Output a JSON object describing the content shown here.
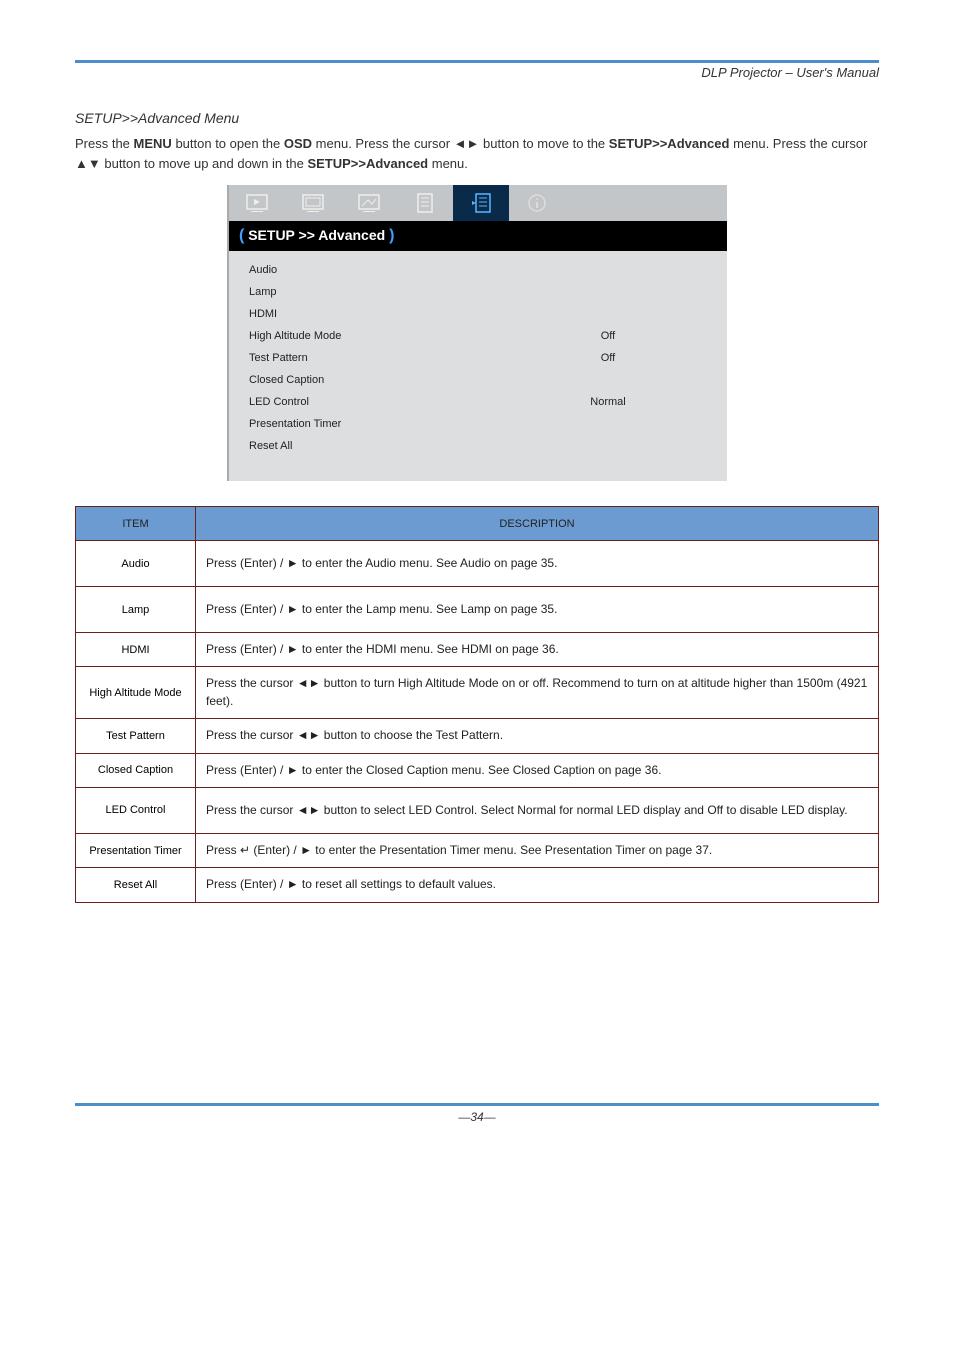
{
  "header": "DLP Projector – User's Manual",
  "section_title": "SETUP>>Advanced Menu",
  "instructions_prefix": "Press the ",
  "instructions_1": " button to open the ",
  "instructions_osd": "OSD",
  "instructions_2": " menu. Press the cursor ",
  "instructions_3": " button to move to the ",
  "instructions_menu_bold": "SETUP>>Advanced",
  "instructions_4": " menu. Press the cursor ",
  "instructions_5": " button to move up and down in the ",
  "instructions_6": " menu.",
  "menu_btn": "MENU",
  "osd": {
    "breadcrumb": "SETUP >> Advanced",
    "items": [
      {
        "label": "Audio",
        "value": ""
      },
      {
        "label": "Lamp",
        "value": ""
      },
      {
        "label": "HDMI",
        "value": ""
      },
      {
        "label": "High Altitude Mode",
        "value": "Off"
      },
      {
        "label": "Test Pattern",
        "value": "Off"
      },
      {
        "label": "Closed Caption",
        "value": ""
      },
      {
        "label": "LED Control",
        "value": "Normal"
      },
      {
        "label": "Presentation Timer",
        "value": ""
      },
      {
        "label": "Reset All",
        "value": ""
      }
    ]
  },
  "table": {
    "headers": [
      "ITEM",
      "DESCRIPTION"
    ],
    "rows": [
      {
        "item": "Audio",
        "desc_pre": "Press ",
        "desc_post": " (Enter) / ► to enter the Audio menu. See Audio on page 35.",
        "h": "md"
      },
      {
        "item": "Lamp",
        "desc_pre": "Press ",
        "desc_post": " (Enter) / ► to enter the Lamp menu. See Lamp on page 35.",
        "h": "md"
      },
      {
        "item": "HDMI",
        "desc_pre": "Press ",
        "desc_post": " (Enter) / ► to enter the HDMI menu. See HDMI on page 36.",
        "h": "sm"
      },
      {
        "item": "High Altitude Mode",
        "desc_pre": "Press the cursor ",
        "desc_post": " button to turn High Altitude Mode on or off. Recommend to turn on at altitude higher than 1500m (4921 feet).",
        "mode": "lr",
        "h": "md"
      },
      {
        "item": "Test Pattern",
        "desc_pre": "Press the cursor ",
        "desc_post": " button to choose the Test Pattern.",
        "mode": "lr",
        "h": "sm"
      },
      {
        "item": "Closed Caption",
        "desc_pre": "Press ",
        "desc_post": " (Enter) / ► to enter the Closed Caption menu. See Closed Caption on page 36.",
        "h": "sm"
      },
      {
        "item": "LED Control",
        "desc_pre": "Press the cursor ",
        "desc_post": " button to select LED Control. Select Normal for normal LED display and Off to disable LED display.",
        "mode": "lr",
        "h": "md"
      },
      {
        "item": "Presentation Timer",
        "desc_pre": "Press ",
        "desc_post": " (Enter) / ► to enter the Presentation Timer menu. See Presentation Timer on page 37.",
        "mode": "enter-r",
        "h": "sm"
      },
      {
        "item": "Reset All",
        "desc_pre": "Press ",
        "desc_post": " (Enter) / ► to reset all settings to default values.",
        "h": "sm"
      }
    ]
  },
  "footer": "—34—"
}
